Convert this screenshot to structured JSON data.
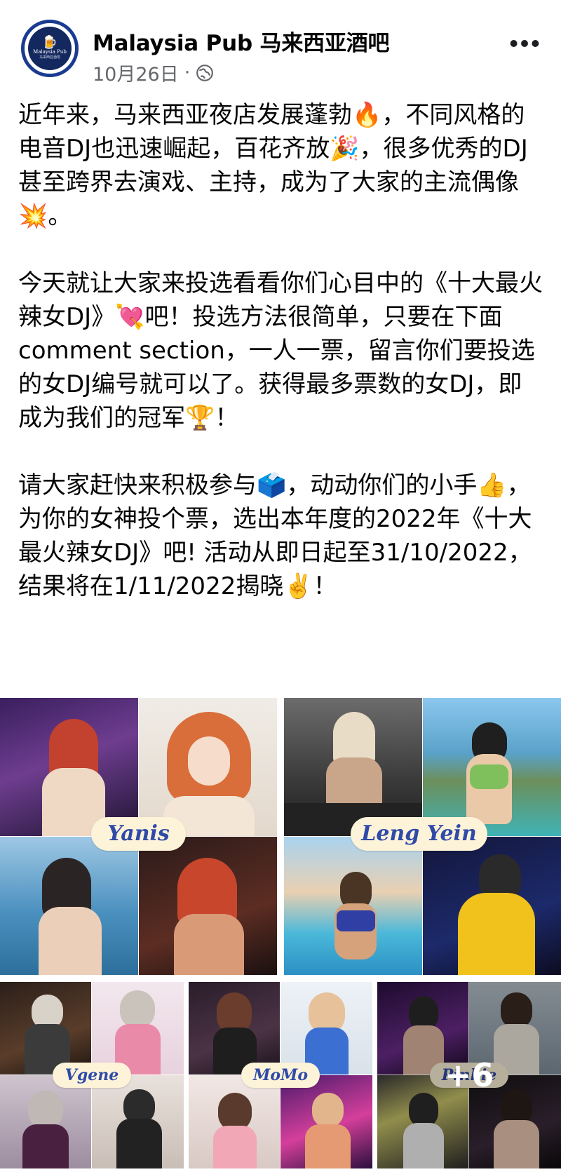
{
  "header": {
    "avatar_brand": "Malaysia Pub",
    "avatar_sub": "马来西亚酒吧",
    "page_name": "Malaysia Pub 马来西亚酒吧",
    "date": "10月26日",
    "separator": "·",
    "privacy_icon": "globe-icon",
    "more_icon": "more-horizontal-icon"
  },
  "post": {
    "paragraphs": [
      "近年来，马来西亚夜店发展蓬勃🔥，不同风格的电音DJ也迅速崛起，百花齐放🎉，很多优秀的DJ甚至跨界去演戏、主持，成为了大家的主流偶像💥。",
      "今天就让大家来投选看看你们心目中的《十大最火辣女DJ》💘吧！投选方法很简单，只要在下面comment section，一人一票，留言你们要投选的女DJ编号就可以了。获得最多票数的女DJ，即成为我们的冠军🏆！",
      "请大家赶快来积极参与🗳️，动动你们的小手👍，为你的女神投个票，选出本年度的2022年《十大最火辣女DJ》吧! 活动从即日起至31/10/2022，结果将在1/11/2022揭晓✌️！"
    ]
  },
  "photos": {
    "labels": [
      "Yanis",
      "Leng Yein",
      "Vgene",
      "MoMo",
      "Pinkie"
    ],
    "more_count": "+6"
  },
  "colors": {
    "avatar_ring": "#1a3b8f",
    "label_bg": "#fdf3d9",
    "label_text": "#2f4aa7",
    "meta_text": "#65676b"
  }
}
